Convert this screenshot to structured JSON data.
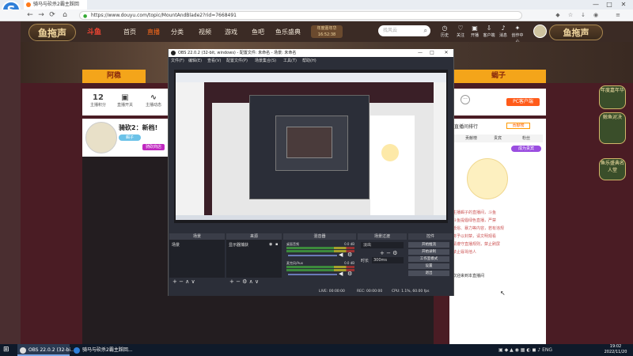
{
  "browser": {
    "tab_title": "骑马与砍杀2霸主踩回",
    "url": "https://www.douyu.com/topic/MountAndBlade2?rid=7668491",
    "window_controls": [
      "—",
      "□",
      "✕"
    ],
    "nav": [
      "←",
      "→",
      "⟳",
      "⌂"
    ]
  },
  "site": {
    "logo_text": "鱼拖声",
    "partner_logo": "斗鱼",
    "links": [
      "首页",
      "直播",
      "分类",
      "视频",
      "游戏",
      "鱼吧",
      "鱼乐盛典"
    ],
    "active_link": "直播",
    "badge_line1": "年度嘉年华",
    "badge_line2": "16:52:38",
    "search_placeholder": "找风云",
    "tools": [
      "历史",
      "关注",
      "开播",
      "客户端",
      "消息",
      "创作中心"
    ],
    "right_logo": "鱼拖声"
  },
  "banner": {
    "tab_left": "阿稳",
    "tab_right": "蝎子"
  },
  "stats": [
    {
      "value": "12",
      "label": "主播积分"
    },
    {
      "value": "",
      "label": "直播开关"
    },
    {
      "value": "",
      "label": "主播动态"
    }
  ],
  "streamer": {
    "title": "骑砍2：新档!",
    "tag1": "蝎子",
    "tag2": "骑砍商店"
  },
  "pc_button": "PC客户端",
  "chat": {
    "header": "直播间排行",
    "tabs": [
      "贡献榜",
      "贵宾",
      "粉丝"
    ],
    "gift_button": "成为贵宾",
    "lines": [
      "主播蝎子的直播间，斗鱼",
      "斗鱼提倡绿色直播，严禁",
      "低俗、暴力等内容，若有违规",
      "将予以封禁，请文明观看",
      "请遵守直播规则，禁止刷屏",
      "禁止辱骂他人"
    ],
    "welcome": "欢迎来到本直播间"
  },
  "right_badges": [
    "年度嘉年华",
    "鲸鱼对决",
    "鱼乐盛典名人堂"
  ],
  "obs": {
    "title": "OBS 22.0.2 (32-bit, windows) - 配置文件: 未命名 - 场景: 未命名",
    "menu": [
      "文件(F)",
      "编辑(E)",
      "查看(V)",
      "配置文件(P)",
      "场景集合(S)",
      "工具(T)",
      "帮助(H)"
    ],
    "docks": [
      {
        "title": "场景",
        "item": "场景"
      },
      {
        "title": "来源",
        "item": "显示器捕获"
      },
      {
        "title": "混音器",
        "item": ""
      },
      {
        "title": "场景过渡",
        "item": "淡出"
      },
      {
        "title": "控件",
        "item": ""
      }
    ],
    "mixer": [
      {
        "name": "桌面音频",
        "db": "0.0 dB"
      },
      {
        "name": "麦克风/Aux",
        "db": "0.0 dB"
      }
    ],
    "transition_duration_label": "时长",
    "transition_duration": "300ms",
    "controls": [
      "开始推流",
      "开始录制",
      "工作室模式",
      "设置",
      "退出"
    ],
    "status": {
      "live": "LIVE: 00:00:00",
      "rec": "REC: 00:00:00",
      "cpu": "CPU: 1.1%, 60.00 fps"
    }
  },
  "taskbar": {
    "start": "⊞",
    "apps": [
      "OBS 22.0.2 (32-bi...",
      "骑马与砍杀2霸主踩回..."
    ],
    "lang": "ENG",
    "time": "19:02",
    "date": "2022/11/20"
  }
}
